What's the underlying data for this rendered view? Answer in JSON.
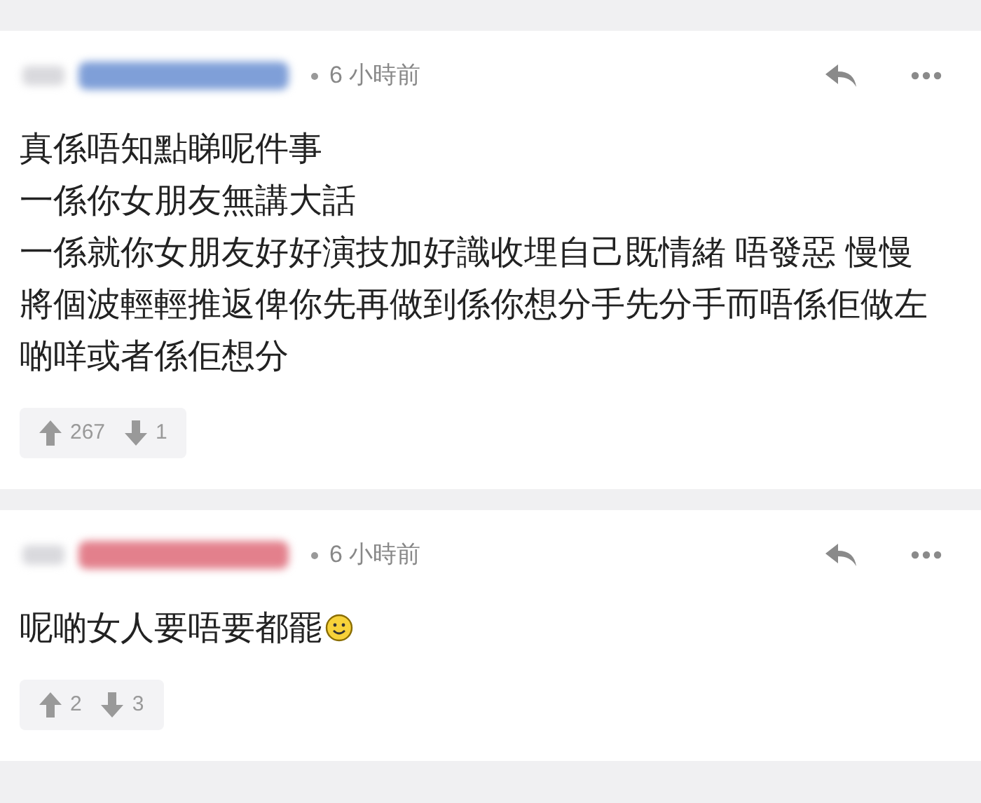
{
  "comments": [
    {
      "color": "#7f9fd8",
      "time": "6 小時前",
      "lines": [
        "真係唔知點睇呢件事",
        "一係你女朋友無講大話",
        "一係就你女朋友好好演技加好識收埋自己既情緒 唔發惡 慢慢將個波輕輕推返俾你先再做到係你想分手先分手而唔係佢做左啲咩或者係佢想分"
      ],
      "upvotes": "267",
      "downvotes": "1"
    },
    {
      "color": "#e3808c",
      "time": "6 小時前",
      "lines": [
        "呢啲女人要唔要都罷"
      ],
      "smiley": true,
      "upvotes": "2",
      "downvotes": "3"
    }
  ]
}
